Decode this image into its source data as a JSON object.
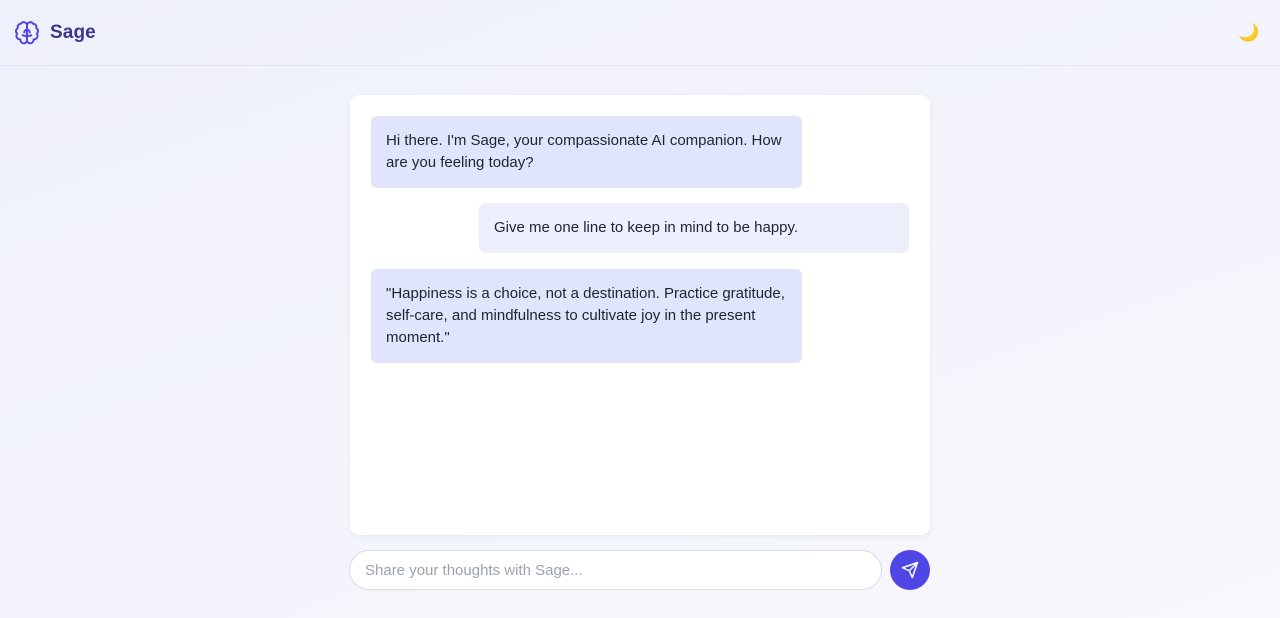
{
  "app": {
    "name": "Sage",
    "brand_icon": "brain-icon",
    "theme_toggle_icon": "moon-icon",
    "theme_toggle_glyph": "🌙",
    "accent_color": "#4f46e5",
    "brand_color": "#3b3590"
  },
  "chat": {
    "messages": [
      {
        "role": "assistant",
        "text": "Hi there. I'm Sage, your compassionate AI companion. How are you feeling today?"
      },
      {
        "role": "user",
        "text": "Give me one line to keep in mind to be happy."
      },
      {
        "role": "assistant",
        "text": "\"Happiness is a choice, not a destination. Practice gratitude, self-care, and mindfulness to cultivate joy in the present moment.\""
      }
    ]
  },
  "composer": {
    "placeholder": "Share your thoughts with Sage...",
    "value": "",
    "send_icon": "send-icon"
  }
}
